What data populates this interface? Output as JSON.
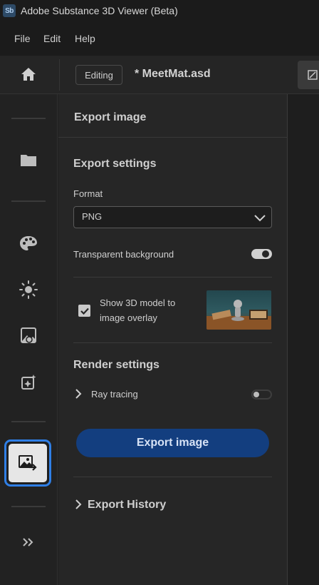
{
  "window": {
    "logo_text": "Sb",
    "title": "Adobe Substance 3D Viewer (Beta)"
  },
  "menu": {
    "items": [
      "File",
      "Edit",
      "Help"
    ]
  },
  "toolbar": {
    "mode_badge": "Editing",
    "file_name": "* MeetMat.asd"
  },
  "left_rail": {
    "icons": [
      "home-icon",
      "folder-icon",
      "palette-icon",
      "sun-icon",
      "environment-image-icon",
      "sparkle-edit-icon",
      "export-image-icon",
      "expand-chevrons-icon"
    ],
    "active": "export-image"
  },
  "panel": {
    "title": "Export image",
    "export_settings": {
      "heading": "Export settings",
      "format_label": "Format",
      "format_value": "PNG",
      "transparent_label": "Transparent background",
      "transparent_on": true,
      "overlay_label": "Show 3D model to image overlay",
      "overlay_checked": true
    },
    "render_settings": {
      "heading": "Render settings",
      "ray_tracing_label": "Ray tracing",
      "ray_tracing_on": false
    },
    "export_button": "Export image",
    "history_label": "Export History"
  },
  "colors": {
    "accent": "#2f7fe6",
    "button": "#133e7f",
    "background": "#262626"
  }
}
